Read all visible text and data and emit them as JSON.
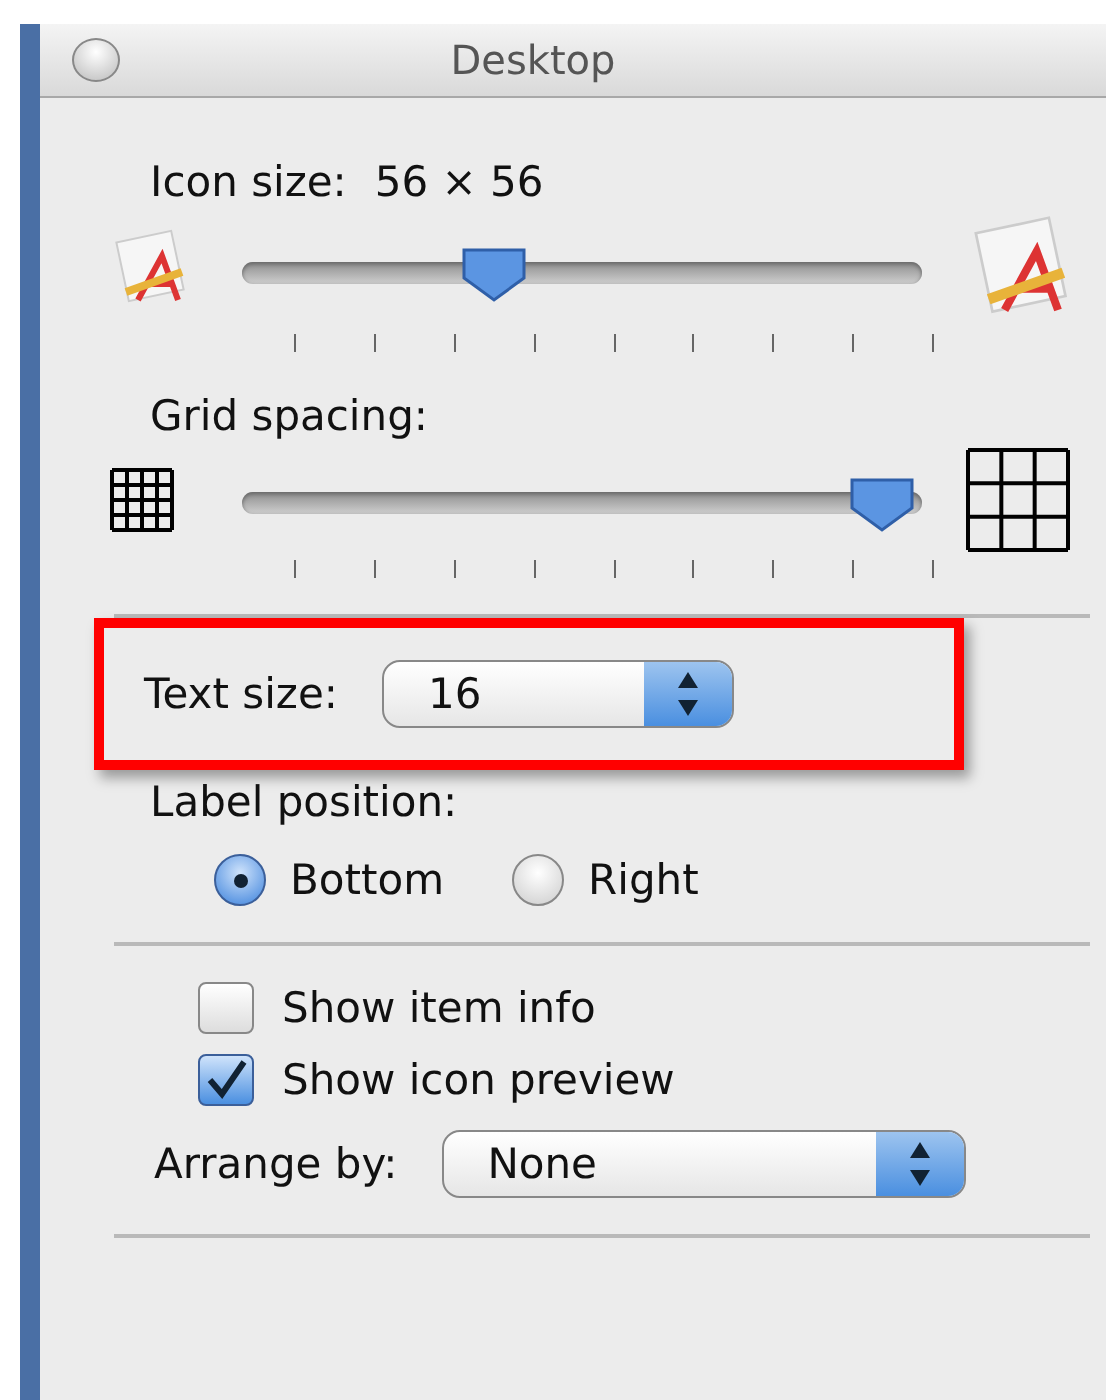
{
  "window": {
    "title": "Desktop"
  },
  "sliders": [
    {
      "kind": "icon-size",
      "label": "Icon size:",
      "reading": "56 × 56",
      "level": 0.37
    },
    {
      "kind": "grid",
      "label": "Grid spacing:",
      "level": 0.94
    }
  ],
  "text_size": {
    "label": "Text size:",
    "value": "16",
    "highlighted": true
  },
  "label_position": {
    "label": "Label position:",
    "options": [
      {
        "label": "Bottom",
        "selected": true
      },
      {
        "label": "Right",
        "selected": false
      }
    ]
  },
  "checkboxes": [
    {
      "label": "Show item info",
      "checked": false
    },
    {
      "label": "Show icon preview",
      "checked": true
    }
  ],
  "arrange_by": {
    "label": "Arrange by:",
    "value": "None"
  }
}
